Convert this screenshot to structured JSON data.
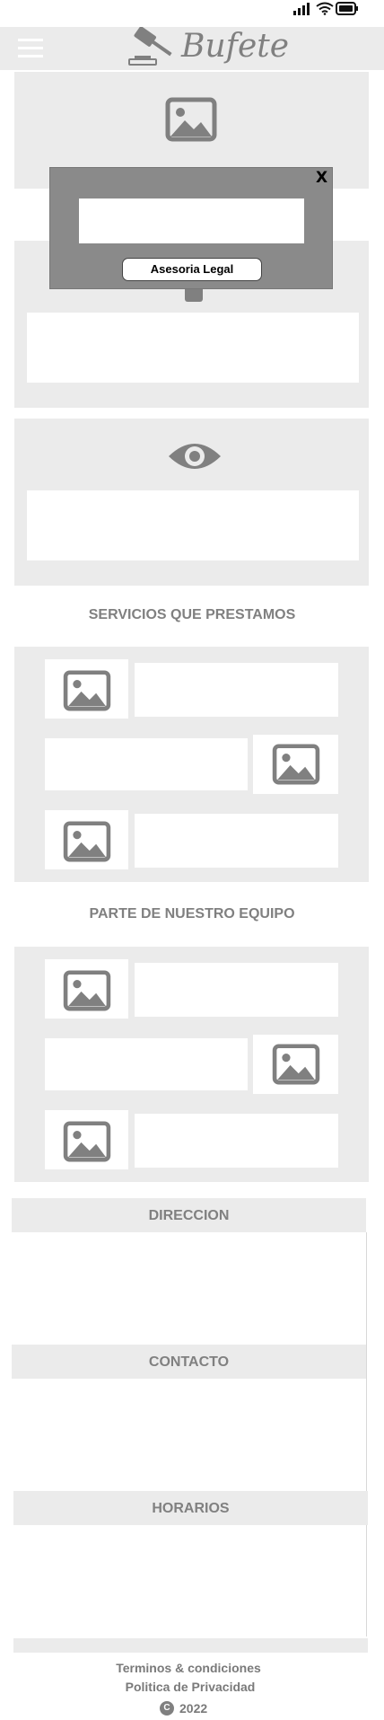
{
  "brand": {
    "name": "Bufete"
  },
  "modal": {
    "close_label": "X",
    "button_label": "Asesoria Legal"
  },
  "sections": {
    "services_title": "SERVICIOS QUE PRESTAMOS",
    "team_title": "PARTE DE NUESTRO EQUIPO",
    "address_title": "DIRECCION",
    "contact_title": "CONTACTO",
    "hours_title": "HORARIOS"
  },
  "footer": {
    "terms": "Terminos & condiciones",
    "privacy": "Politica de Privacidad",
    "copyright_symbol": "C",
    "year": "2022"
  },
  "colors": {
    "accent_gray": "#808080",
    "panel_bg": "#ebebeb",
    "modal_bg": "#8a8a8a"
  }
}
